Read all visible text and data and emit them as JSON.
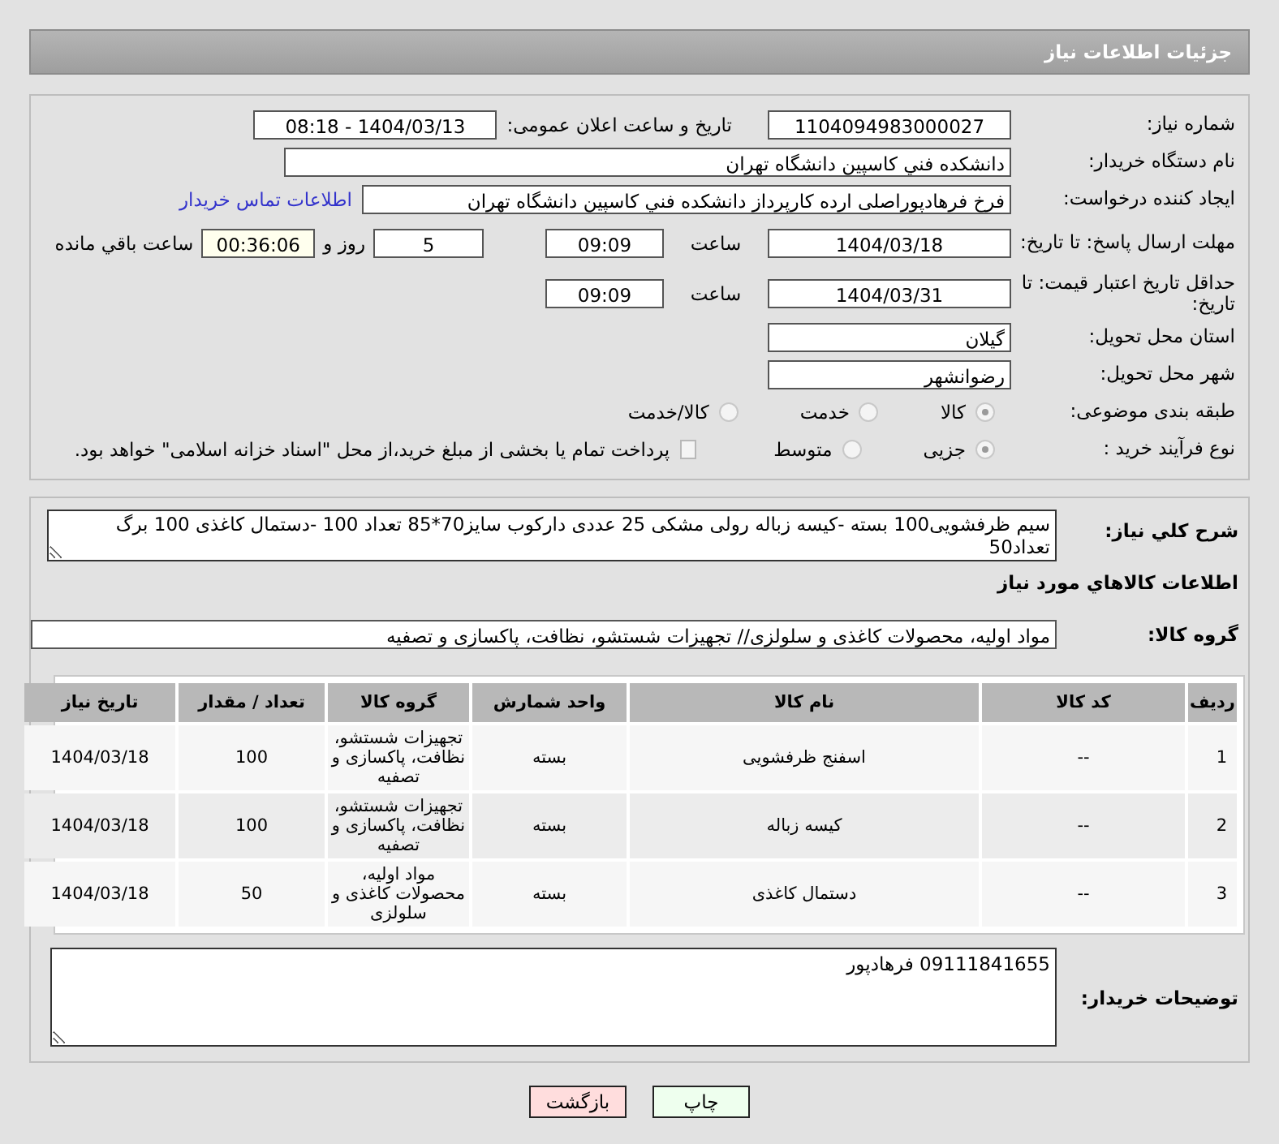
{
  "header": {
    "title": "جزئیات اطلاعات نیاز"
  },
  "need_number": {
    "label": "شماره نیاز:",
    "value": "1104094983000027"
  },
  "announce": {
    "label": "تاریخ و ساعت اعلان عمومی:",
    "value": "1404/03/13 - 08:18"
  },
  "buyer": {
    "label": "نام دستگاه خریدار:",
    "value": "دانشکده فني کاسپين دانشگاه تهران"
  },
  "requester": {
    "label": "ایجاد کننده درخواست:",
    "value": "فرخ فرهادپوراصلی اردە کارپرداز دانشکده فني کاسپين دانشگاه تهران",
    "link": "اطلاعات تماس خریدار"
  },
  "deadline": {
    "label": "مهلت ارسال پاسخ: تا تاریخ:",
    "date": "1404/03/18",
    "time_label": "ساعت",
    "time": "09:09",
    "days": "5",
    "days_label": "روز و",
    "remaining": "00:36:06",
    "remaining_label": "ساعت باقي مانده"
  },
  "validity": {
    "label": "حداقل تاریخ اعتبار قیمت: تا تاریخ:",
    "date": "1404/03/31",
    "time_label": "ساعت",
    "time": "09:09"
  },
  "province": {
    "label": "استان محل تحویل:",
    "value": "گیلان"
  },
  "city": {
    "label": "شهر محل تحویل:",
    "value": "رضوانشهر"
  },
  "category": {
    "label": "طبقه بندی موضوعی:",
    "options": [
      {
        "label": "کالا",
        "selected": true
      },
      {
        "label": "خدمت",
        "selected": false
      },
      {
        "label": "کالا/خدمت",
        "selected": false
      }
    ]
  },
  "purchase_type": {
    "label": "نوع فرآیند خرید :",
    "options": [
      {
        "label": "جزیی",
        "selected": true
      },
      {
        "label": "متوسط",
        "selected": false
      }
    ],
    "payment": {
      "label": "پرداخت تمام یا بخشی از مبلغ خرید،از محل \"اسناد خزانه اسلامی\" خواهد بود.",
      "checked": false
    }
  },
  "description": {
    "label": "شرح کلي نیاز:",
    "value": "سیم ظرفشویی100 بسته -کیسه زباله رولی مشکی 25 عددی دارکوب سایز70*85 تعداد 100 -دستمال کاغذی 100 برگ تعداد50"
  },
  "goods_title": "اطلاعات کالاهاي مورد نیاز",
  "goods_group": {
    "label": "گروه کالا:",
    "value": "مواد اولیه، محصولات کاغذی و سلولزی// تجهیزات شستشو، نظافت، پاکسازی و تصفیه"
  },
  "table": {
    "columns": [
      "ردیف",
      "کد کالا",
      "نام کالا",
      "واحد شمارش",
      "گروه کالا",
      "تعداد / مقدار",
      "تاریخ نیاز"
    ],
    "rows": [
      [
        "1",
        "--",
        "اسفنج ظرفشویی",
        "بسته",
        "تجهیزات شستشو، نظافت، پاکسازی و تصفیه",
        "100",
        "1404/03/18"
      ],
      [
        "2",
        "--",
        "کیسه زباله",
        "بسته",
        "تجهیزات شستشو، نظافت، پاکسازی و تصفیه",
        "100",
        "1404/03/18"
      ],
      [
        "3",
        "--",
        "دستمال کاغذی",
        "بسته",
        "مواد اولیه، محصولات کاغذی و سلولزی",
        "50",
        "1404/03/18"
      ]
    ]
  },
  "buyer_notes": {
    "label": "توضیحات خریدار:",
    "value": "09111841655 فرهادپور"
  },
  "buttons": [
    {
      "label": "چاپ",
      "kind": "print"
    },
    {
      "label": "بازگشت",
      "kind": "back"
    }
  ]
}
